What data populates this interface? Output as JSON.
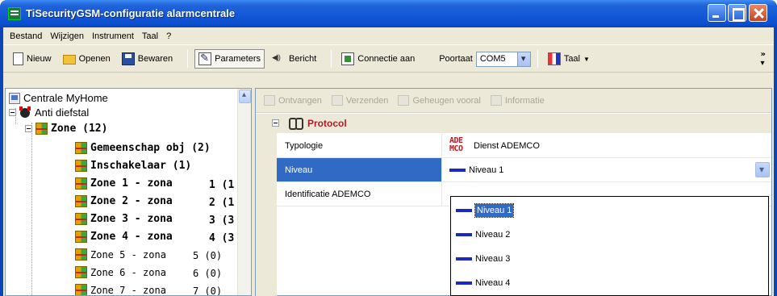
{
  "window": {
    "title": "TiSecurityGSM-configuratie  alarmcentrale"
  },
  "menu": [
    "Bestand",
    "Wijzigen",
    "Instrument",
    "Taal",
    "?"
  ],
  "toolbar": {
    "new_label": "Nieuw",
    "open_label": "Openen",
    "save_label": "Bewaren",
    "params_label": "Parameters",
    "message_label": "Bericht",
    "connect_label": "Connectie aan",
    "port_label": "Poortaat",
    "port_value": "COM5",
    "language_label": "Taal"
  },
  "tree": {
    "root": "Centrale MyHome",
    "anti_theft": "Anti diefstal",
    "zone_group": "Zone (12)",
    "items": [
      {
        "label": "Gemeenschap obj (2)",
        "count": "",
        "bold": true
      },
      {
        "label": "Inschakelaar (1)",
        "count": "",
        "bold": true
      },
      {
        "label": "Zone 1 - zona",
        "count": "1 (1",
        "bold": true
      },
      {
        "label": "Zone 2 - zona",
        "count": "2 (1",
        "bold": true
      },
      {
        "label": "Zone 3 - zona",
        "count": "3 (3",
        "bold": true
      },
      {
        "label": "Zone 4 - zona",
        "count": "4 (3",
        "bold": true
      },
      {
        "label": "Zone 5 - zona",
        "count": "5 (0)",
        "bold": false
      },
      {
        "label": "Zone 6 - zona",
        "count": "6 (0)",
        "bold": false
      },
      {
        "label": "Zone 7 - zona",
        "count": "7 (0)",
        "bold": false
      }
    ]
  },
  "right_toolbar": {
    "receive": "Ontvangen",
    "send": "Verzenden",
    "memory": "Geheugen vooral",
    "info": "Informatie"
  },
  "properties": {
    "category": "Protocol",
    "typology_label": "Typologie",
    "typology_icon_text": "ADE MCO",
    "typology_value": "Dienst ADEMCO",
    "level_label": "Niveau",
    "level_value": "Niveau 1",
    "ident_label": "Identificatie ADEMCO"
  },
  "dropdown": {
    "options": [
      "Niveau 1",
      "Niveau 2",
      "Niveau 3",
      "Niveau 4"
    ],
    "selected": "Niveau 1"
  }
}
